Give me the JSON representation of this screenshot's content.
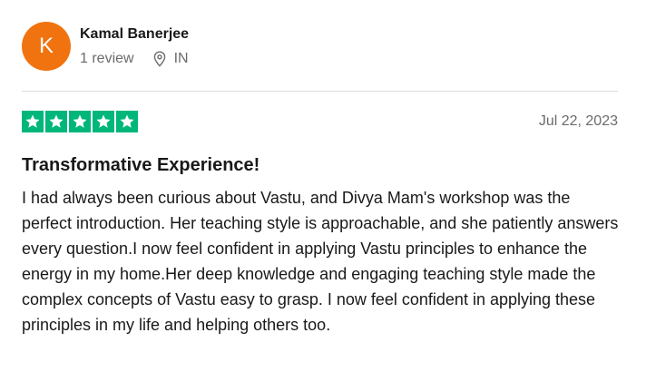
{
  "reviewer": {
    "avatar_initial": "K",
    "avatar_color": "#f0730f",
    "name": "Kamal Banerjee",
    "review_count": "1 review",
    "location_icon": "location-pin-icon",
    "country": "IN"
  },
  "review": {
    "rating": 5,
    "rating_max": 5,
    "star_color": "#00b67a",
    "star_icon": "star-icon",
    "date": "Jul 22, 2023",
    "title": "Transformative Experience!",
    "body": "I had always been curious about Vastu, and Divya Mam's workshop was the perfect introduction. Her teaching style is approachable, and she patiently answers every question.I now feel confident in applying Vastu principles to enhance the energy in my home.Her deep knowledge and engaging teaching style made the complex concepts of Vastu easy to grasp. I now feel confident in applying these principles in my life and helping others too."
  }
}
